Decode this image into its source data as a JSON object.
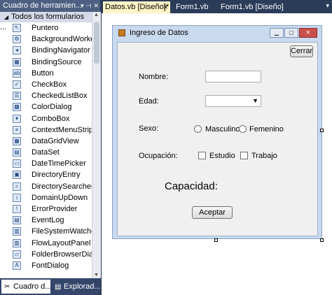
{
  "toolbox": {
    "title": "Cuadro de herramien...",
    "section": "Todos los formularios ...",
    "items": [
      {
        "label": "Puntero",
        "icon": "pointer-icon",
        "glyph": "↖"
      },
      {
        "label": "BackgroundWorker",
        "icon": "backgroundworker-icon",
        "glyph": "⚙"
      },
      {
        "label": "BindingNavigator",
        "icon": "bindingnavigator-icon",
        "glyph": "◂"
      },
      {
        "label": "BindingSource",
        "icon": "bindingsource-icon",
        "glyph": "▦"
      },
      {
        "label": "Button",
        "icon": "button-icon",
        "glyph": "ab"
      },
      {
        "label": "CheckBox",
        "icon": "checkbox-icon",
        "glyph": "✓"
      },
      {
        "label": "CheckedListBox",
        "icon": "checkedlistbox-icon",
        "glyph": "☰"
      },
      {
        "label": "ColorDialog",
        "icon": "colordialog-icon",
        "glyph": "▩"
      },
      {
        "label": "ComboBox",
        "icon": "combobox-icon",
        "glyph": "▾"
      },
      {
        "label": "ContextMenuStrip",
        "icon": "contextmenustrip-icon",
        "glyph": "≡"
      },
      {
        "label": "DataGridView",
        "icon": "datagridview-icon",
        "glyph": "▦"
      },
      {
        "label": "DataSet",
        "icon": "dataset-icon",
        "glyph": "▤"
      },
      {
        "label": "DateTimePicker",
        "icon": "datetimepicker-icon",
        "glyph": "▭"
      },
      {
        "label": "DirectoryEntry",
        "icon": "directoryentry-icon",
        "glyph": "▣"
      },
      {
        "label": "DirectorySearcher",
        "icon": "directorysearcher-icon",
        "glyph": "⌕"
      },
      {
        "label": "DomainUpDown",
        "icon": "domainupdown-icon",
        "glyph": "↕"
      },
      {
        "label": "ErrorProvider",
        "icon": "errorprovider-icon",
        "glyph": "!"
      },
      {
        "label": "EventLog",
        "icon": "eventlog-icon",
        "glyph": "▤"
      },
      {
        "label": "FileSystemWatcher",
        "icon": "filesystemwatcher-icon",
        "glyph": "▥"
      },
      {
        "label": "FlowLayoutPanel",
        "icon": "flowlayoutpanel-icon",
        "glyph": "▥"
      },
      {
        "label": "FolderBrowserDial...",
        "icon": "folderbrowserdialog-icon",
        "glyph": "▱"
      },
      {
        "label": "FontDialog",
        "icon": "fontdialog-icon",
        "glyph": "A"
      }
    ],
    "tabs": [
      "Cuadro d...",
      "Explorad..."
    ]
  },
  "doc_tabs": [
    "Datos.vb [Diseño]*",
    "Form1.vb",
    "Form1.vb [Diseño]"
  ],
  "form": {
    "title": "Ingreso de Datos",
    "cerrar": "Cerrar",
    "nombre": "Nombre:",
    "edad": "Edad:",
    "sexo": "Sexo:",
    "masculino": "Masculino",
    "femenino": "Femenino",
    "ocupacion": "Ocupación:",
    "estudio": "Estudio",
    "trabajo": "Trabajo",
    "capacidad": "Capacidad:",
    "aceptar": "Aceptar"
  }
}
